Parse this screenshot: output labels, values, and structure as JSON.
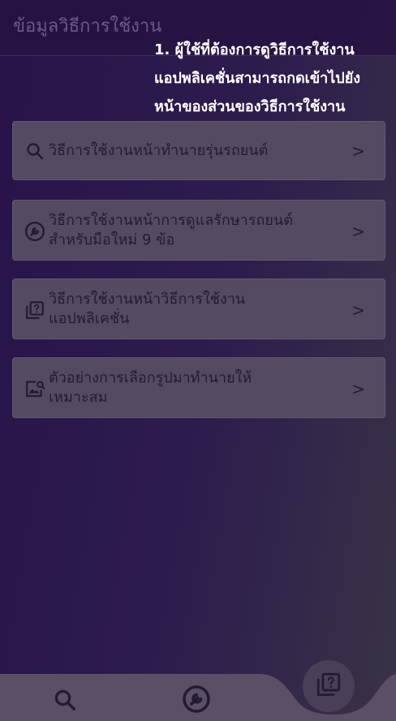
{
  "header": {
    "title": "ข้อมูลวิธีการใช้งาน"
  },
  "tutorial": {
    "text": "1. ผู้ใช้ที่ต้องการดูวิธีการใช้งาน\nแอปพลิเคชั่นสามารถกดเข้าไปยัง\nหน้าของส่วนของวิธีการใช้งาน"
  },
  "menu": {
    "items": [
      {
        "icon": "search-icon",
        "label": "วิธีการใช้งานหน้าทำนายรุ่นรถยนต์",
        "chevron": ">"
      },
      {
        "icon": "wrench-icon",
        "label": "วิธีการใช้งานหน้าการดูแลรักษารถยนต์\nสำหรับมือใหม่ 9 ข้อ",
        "chevron": ">"
      },
      {
        "icon": "help-copy-icon",
        "label": "วิธีการใช้งานหน้าวิธีการใช้งาน\nแอปพลิเคชั่น",
        "chevron": ">"
      },
      {
        "icon": "image-search-icon",
        "label": "ตัวอย่างการเลือกรูปมาทำนายให้\nเหมาะสม",
        "chevron": ">"
      }
    ]
  },
  "tabbar": {
    "tabs": [
      {
        "icon": "search-icon",
        "name": "predict"
      },
      {
        "icon": "wrench-icon",
        "name": "maintenance"
      },
      {
        "icon": "help-copy-icon",
        "name": "how-to",
        "active": true
      }
    ],
    "colors": {
      "bar": "#5a4f66",
      "active": "#4a3f58",
      "icon": "#231a33"
    }
  }
}
